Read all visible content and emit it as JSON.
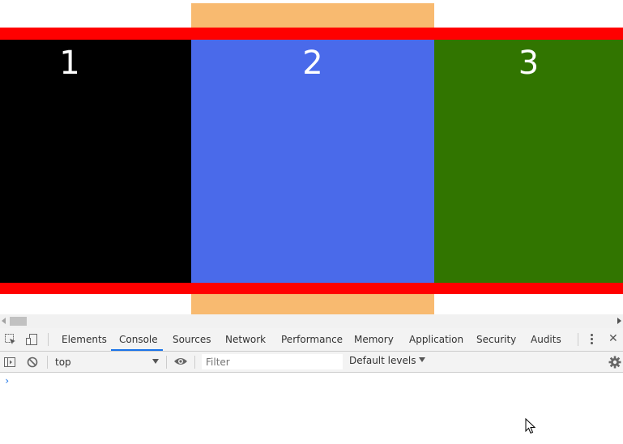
{
  "page": {
    "boxes": [
      {
        "label": "1",
        "color": "#000000"
      },
      {
        "label": "2",
        "color": "#4a6aea"
      },
      {
        "label": "3",
        "color": "#317500"
      }
    ],
    "band_color": "#ff0000",
    "background_column_color": "#f8ba70"
  },
  "devtools": {
    "tabs": [
      "Elements",
      "Console",
      "Sources",
      "Network",
      "Performance",
      "Memory",
      "Application",
      "Security",
      "Audits"
    ],
    "active_tab": "Console",
    "context_select": "top",
    "filter_placeholder": "Filter",
    "levels_label": "Default levels",
    "prompt_symbol": "›",
    "close_symbol": "✕",
    "accent_color": "#1a73e8"
  }
}
